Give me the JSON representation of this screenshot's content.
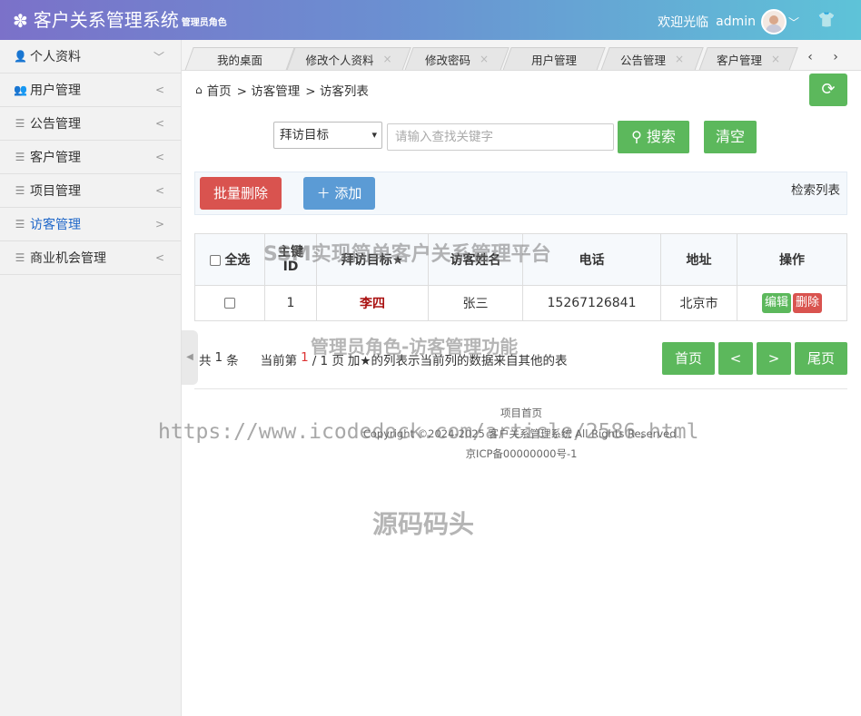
{
  "header": {
    "title": "客户关系管理系统",
    "role": "管理员角色",
    "welcome": "欢迎光临",
    "username": "admin"
  },
  "sidebar": {
    "items": [
      {
        "label": "个人资料",
        "icon": "person-icon",
        "arrow": "﹀"
      },
      {
        "label": "用户管理",
        "icon": "users-icon",
        "arrow": "<"
      },
      {
        "label": "公告管理",
        "icon": "list-icon",
        "arrow": "<"
      },
      {
        "label": "客户管理",
        "icon": "list-icon",
        "arrow": "<"
      },
      {
        "label": "项目管理",
        "icon": "list-icon",
        "arrow": "<"
      },
      {
        "label": "访客管理",
        "icon": "list-icon",
        "arrow": ">",
        "active": true
      },
      {
        "label": "商业机会管理",
        "icon": "list-icon",
        "arrow": "<"
      }
    ]
  },
  "tabs": [
    {
      "label": "我的桌面",
      "closable": false
    },
    {
      "label": "修改个人资料",
      "closable": true
    },
    {
      "label": "修改密码",
      "closable": true
    },
    {
      "label": "用户管理",
      "closable": false
    },
    {
      "label": "公告管理",
      "closable": true
    },
    {
      "label": "客户管理",
      "closable": true
    }
  ],
  "breadcrumb": {
    "home": "首页",
    "level1": "> 访客管理",
    "level2": "> 访客列表"
  },
  "search": {
    "select_value": "拜访目标",
    "placeholder": "请输入查找关键字",
    "search_label": "搜索",
    "clear_label": "清空"
  },
  "toolbar": {
    "batch_delete": "批量删除",
    "add": "添加",
    "search_list": "检索列表"
  },
  "table": {
    "headers": [
      "全选",
      "主键ID",
      "拜访目标★",
      "访客姓名",
      "电话",
      "地址",
      "操作"
    ],
    "rows": [
      {
        "id": "1",
        "target": "李四",
        "visitor": "张三",
        "phone": "15267126841",
        "address": "北京市",
        "edit": "编辑",
        "delete": "删除"
      }
    ]
  },
  "pager": {
    "total_prefix": "共",
    "total": "1",
    "total_suffix": "条",
    "current_prefix": "当前第",
    "current": "1",
    "pages_suffix": "/ 1 页",
    "note": "加★的列表示当前列的数据来自其他的表",
    "first": "首页",
    "prev": "<",
    "next": ">",
    "last": "尾页"
  },
  "footer": {
    "line1": "项目首页",
    "line2": "Copyright ©2024-2025 客户关系管理系统 All Rights Reserved.",
    "line3": "京ICP备00000000号-1"
  },
  "watermarks": {
    "w1": "SSM实现简单客户关系管理平台",
    "w2": "管理员角色-访客管理功能",
    "w3": "https://www.icodedock.com/article/2586.html",
    "w4": "源码码头"
  },
  "colors": {
    "green": "#5cb85c",
    "red": "#d9534f",
    "blue": "#5b9bd5",
    "active_nav": "#1e66c8"
  }
}
